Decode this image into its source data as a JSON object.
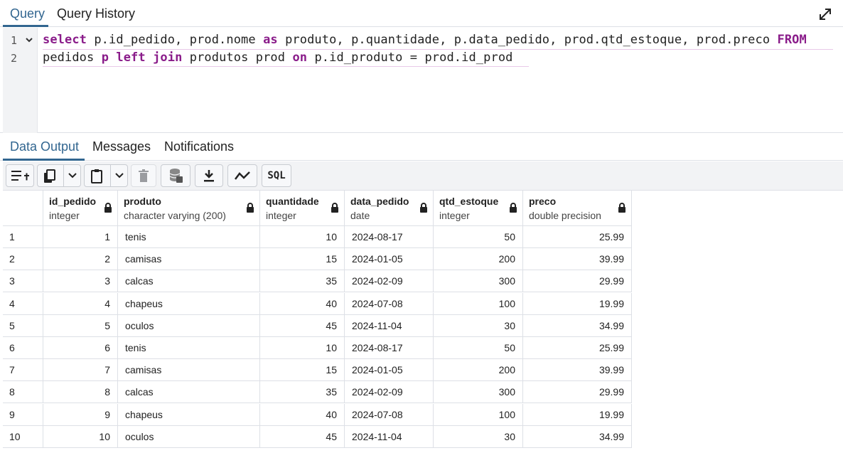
{
  "top_tabs": [
    "Query",
    "Query History"
  ],
  "query": {
    "lines": [
      {
        "no": "1",
        "tokens": [
          {
            "t": "select",
            "kw": true
          },
          {
            "t": " p.id_pedido, prod.nome ",
            "kw": false
          },
          {
            "t": "as",
            "kw": true
          },
          {
            "t": " produto, p.quantidade, p.data_pedido, prod.qtd_estoque, prod.preco ",
            "kw": false
          },
          {
            "t": "FROM",
            "kw": true
          }
        ]
      },
      {
        "no": "2",
        "tokens": [
          {
            "t": "pedidos ",
            "kw": false
          },
          {
            "t": "p",
            "kw": true
          },
          {
            "t": " ",
            "kw": false
          },
          {
            "t": "left",
            "kw": true
          },
          {
            "t": " ",
            "kw": false
          },
          {
            "t": "join",
            "kw": true
          },
          {
            "t": " produtos prod ",
            "kw": false
          },
          {
            "t": "on",
            "kw": true
          },
          {
            "t": " p.id_produto = prod.id_prod",
            "kw": false
          }
        ]
      }
    ]
  },
  "output_tabs": [
    "Data Output",
    "Messages",
    "Notifications"
  ],
  "toolbar": {
    "icons": [
      "add-row-icon",
      "copy-icon",
      "chevron-down-icon",
      "paste-icon",
      "chevron-down-icon",
      "delete-icon",
      "save-data-icon",
      "download-icon",
      "graph-icon",
      "sql-icon"
    ],
    "sql_label": "SQL"
  },
  "columns": [
    {
      "name": "id_pedido",
      "type": "integer",
      "align": "num"
    },
    {
      "name": "produto",
      "type": "character varying (200)",
      "align": "txt"
    },
    {
      "name": "quantidade",
      "type": "integer",
      "align": "num"
    },
    {
      "name": "data_pedido",
      "type": "date",
      "align": "txt"
    },
    {
      "name": "qtd_estoque",
      "type": "integer",
      "align": "num"
    },
    {
      "name": "preco",
      "type": "double precision",
      "align": "num"
    }
  ],
  "rows": [
    [
      "1",
      "tenis",
      "10",
      "2024-08-17",
      "50",
      "25.99"
    ],
    [
      "2",
      "camisas",
      "15",
      "2024-01-05",
      "200",
      "39.99"
    ],
    [
      "3",
      "calcas",
      "35",
      "2024-02-09",
      "300",
      "29.99"
    ],
    [
      "4",
      "chapeus",
      "40",
      "2024-07-08",
      "100",
      "19.99"
    ],
    [
      "5",
      "oculos",
      "45",
      "2024-11-04",
      "30",
      "34.99"
    ],
    [
      "6",
      "tenis",
      "10",
      "2024-08-17",
      "50",
      "25.99"
    ],
    [
      "7",
      "camisas",
      "15",
      "2024-01-05",
      "200",
      "39.99"
    ],
    [
      "8",
      "calcas",
      "35",
      "2024-02-09",
      "300",
      "29.99"
    ],
    [
      "9",
      "chapeus",
      "40",
      "2024-07-08",
      "100",
      "19.99"
    ],
    [
      "10",
      "oculos",
      "45",
      "2024-11-04",
      "30",
      "34.99"
    ]
  ],
  "row_numbers": [
    "1",
    "2",
    "3",
    "4",
    "5",
    "6",
    "7",
    "8",
    "9",
    "10"
  ],
  "colors": {
    "accent": "#326690",
    "keyword": "#8a1c8a"
  }
}
